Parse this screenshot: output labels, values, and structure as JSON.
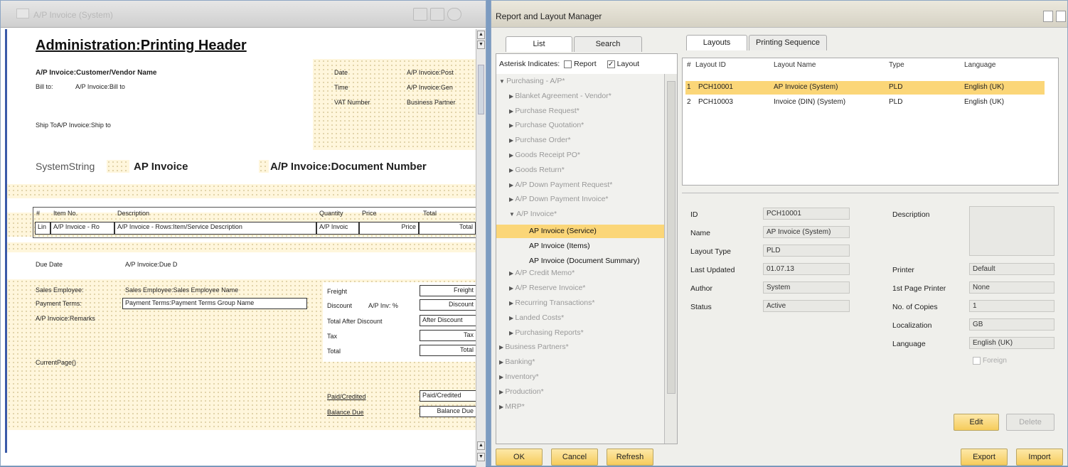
{
  "left_window": {
    "title": "A/P Invoice (System)",
    "header": "Administration:Printing Header",
    "customer_name": "A/P Invoice:Customer/Vendor Name",
    "bill_to_label": "Bill to:",
    "bill_to_value": "A/P Invoice:Bill to",
    "date_label": "Date",
    "date_value": "A/P Invoice:Post",
    "time_label": "Time",
    "time_value": "A/P Invoice:Gen",
    "vat_label": "VAT Number",
    "vat_value": "Business Partner",
    "ship_to_label": "Ship To:",
    "ship_to_value": "A/P Invoice:Ship to",
    "system_string": "SystemString",
    "doc_title": "AP Invoice",
    "doc_number": "A/P Invoice:Document Number",
    "columns": [
      "#",
      "Item No.",
      "Description",
      "Quantity",
      "Price",
      "Total"
    ],
    "row_cells": [
      "Lin",
      "A/P Invoice - Ro",
      "A/P Invoice - Rows:Item/Service Description",
      "A/P Invoic",
      "Price",
      "Total"
    ],
    "due_date_label": "Due Date",
    "due_date_value": "A/P Invoice:Due D",
    "sales_employee_label": "Sales Employee:",
    "sales_employee_value": "Sales Employee:Sales Employee Name",
    "payment_terms_label": "Payment Terms:",
    "payment_terms_value": "Payment Terms:Payment Terms Group Name",
    "remarks": "A/P Invoice:Remarks",
    "current_page": "CurrentPage()",
    "freight_label": "Freight",
    "freight_value": "Freight",
    "discount_label": "Discount",
    "discount_pct": "A/P Inv: %",
    "discount_value": "Discount",
    "total_after_discount_label": "Total After Discount",
    "total_after_discount_value": "After Discount",
    "tax_label": "Tax",
    "tax_value": "Tax",
    "total_label": "Total",
    "total_value": "Total",
    "paid_label": "Paid/Credited",
    "paid_value": "Paid/Credited",
    "balance_label": "Balance Due",
    "balance_value": "Balance Due"
  },
  "right_window": {
    "title": "Report and Layout Manager",
    "left_tabs": [
      "List",
      "Search"
    ],
    "asterisk_label": "Asterisk Indicates:",
    "report_label": "Report",
    "layout_label": "Layout",
    "tree": [
      {
        "label": "Purchasing - A/P*",
        "depth": 0,
        "style": "muted"
      },
      {
        "label": "Blanket Agreement - Vendor*",
        "depth": 1,
        "style": "muted"
      },
      {
        "label": "Purchase Request*",
        "depth": 1,
        "style": "muted"
      },
      {
        "label": "Purchase Quotation*",
        "depth": 1,
        "style": "muted"
      },
      {
        "label": "Purchase Order*",
        "depth": 1,
        "style": "muted"
      },
      {
        "label": "Goods Receipt PO*",
        "depth": 1,
        "style": "muted"
      },
      {
        "label": "Goods Return*",
        "depth": 1,
        "style": "muted"
      },
      {
        "label": "A/P Down Payment Request*",
        "depth": 1,
        "style": "muted"
      },
      {
        "label": "A/P Down Payment Invoice*",
        "depth": 1,
        "style": "muted"
      },
      {
        "label": "A/P Invoice*",
        "depth": 1,
        "style": "muted"
      },
      {
        "label": "AP Invoice (Service)",
        "depth": 2,
        "style": "selected"
      },
      {
        "label": "AP Invoice (Items)",
        "depth": 2,
        "style": "dark"
      },
      {
        "label": "AP Invoice (Document Summary)",
        "depth": 2,
        "style": "dark"
      },
      {
        "label": "A/P Credit Memo*",
        "depth": 1,
        "style": "muted"
      },
      {
        "label": "A/P Reserve Invoice*",
        "depth": 1,
        "style": "muted"
      },
      {
        "label": "Recurring Transactions*",
        "depth": 1,
        "style": "muted"
      },
      {
        "label": "Landed Costs*",
        "depth": 1,
        "style": "muted"
      },
      {
        "label": "Purchasing Reports*",
        "depth": 1,
        "style": "muted"
      },
      {
        "label": "Business Partners*",
        "depth": 0,
        "style": "muted"
      },
      {
        "label": "Banking*",
        "depth": 0,
        "style": "muted"
      },
      {
        "label": "Inventory*",
        "depth": 0,
        "style": "muted"
      },
      {
        "label": "Production*",
        "depth": 0,
        "style": "muted"
      },
      {
        "label": "MRP*",
        "depth": 0,
        "style": "muted"
      }
    ],
    "right_tabs": [
      "Layouts",
      "Printing Sequence"
    ],
    "grid_headers": [
      "#",
      "Layout ID",
      "Layout Name",
      "Type",
      "Language"
    ],
    "grid_rows": [
      [
        "1",
        "PCH10001",
        "AP Invoice (System)",
        "PLD",
        "English (UK)"
      ],
      [
        "2",
        "PCH10003",
        "Invoice (DIN) (System)",
        "PLD",
        "English (UK)"
      ]
    ],
    "details": {
      "id_label": "ID",
      "id": "PCH10001",
      "name_label": "Name",
      "name": "AP Invoice (System)",
      "type_label": "Layout Type",
      "type": "PLD",
      "updated_label": "Last Updated",
      "updated": "01.07.13",
      "author_label": "Author",
      "author": "System",
      "status_label": "Status",
      "status": "Active",
      "description_label": "Description",
      "printer_label": "Printer",
      "printer": "Default",
      "first_printer_label": "1st Page Printer",
      "first_printer": "None",
      "copies_label": "No. of Copies",
      "copies": "1",
      "localization_label": "Localization",
      "localization": "GB",
      "language_label": "Language",
      "language": "English (UK)",
      "foreign_label": "Foreign"
    },
    "buttons": {
      "ok": "OK",
      "cancel": "Cancel",
      "refresh": "Refresh",
      "edit": "Edit",
      "delete": "Delete",
      "export": "Export",
      "import": "Import"
    }
  }
}
